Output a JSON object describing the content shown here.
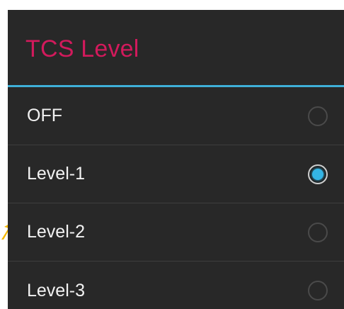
{
  "dialog": {
    "title": "TCS Level",
    "options": [
      {
        "label": "OFF",
        "selected": false
      },
      {
        "label": "Level-1",
        "selected": true
      },
      {
        "label": "Level-2",
        "selected": false
      },
      {
        "label": "Level-3",
        "selected": false
      }
    ]
  },
  "colors": {
    "title": "#d21a5c",
    "divider": "#3fb0d8",
    "background": "#282828",
    "radio_selected": "#34b5e5",
    "pointer_arrow": "#f5b800"
  },
  "icons": {
    "pointer": "arrow-pointer-icon",
    "radio_on": "radio-selected-icon",
    "radio_off": "radio-unselected-icon"
  }
}
